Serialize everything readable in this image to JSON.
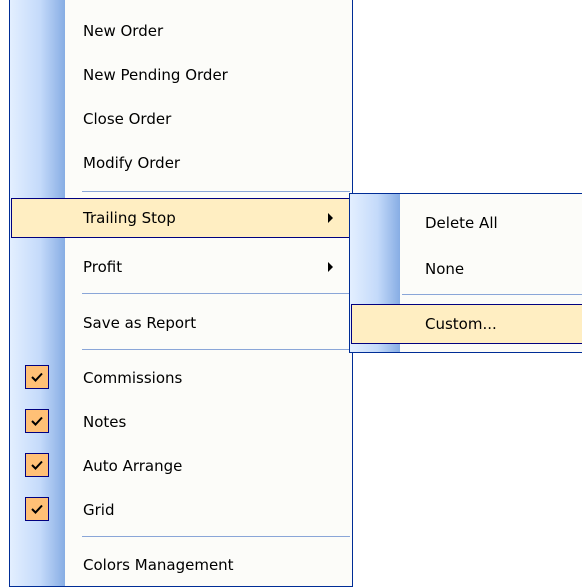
{
  "main_menu": {
    "items": [
      {
        "label": "New Order"
      },
      {
        "label": "New Pending Order"
      },
      {
        "label": "Close Order"
      },
      {
        "label": "Modify Order"
      },
      {
        "label": "Trailing Stop",
        "submenu": true,
        "highlighted": true
      },
      {
        "label": "Profit",
        "submenu": true
      },
      {
        "label": "Save as Report"
      },
      {
        "label": "Commissions",
        "checked": true
      },
      {
        "label": "Notes",
        "checked": true
      },
      {
        "label": "Auto Arrange",
        "checked": true
      },
      {
        "label": "Grid",
        "checked": true
      },
      {
        "label": "Colors Management"
      }
    ]
  },
  "submenu": {
    "parent": "Trailing Stop",
    "items": [
      {
        "label": "Delete All"
      },
      {
        "label": "None"
      },
      {
        "label": "Custom...",
        "highlighted": true
      }
    ]
  },
  "colors": {
    "highlight": "#ffeec2",
    "highlight_border": "#000080",
    "check_background": "#ffc076",
    "gutter_light": "#e3efff",
    "gutter_dark": "#87ade4",
    "separator": "#8aa6d8"
  },
  "icons": {
    "check": "checkmark-icon",
    "submenu_arrow": "arrow-right-icon"
  }
}
